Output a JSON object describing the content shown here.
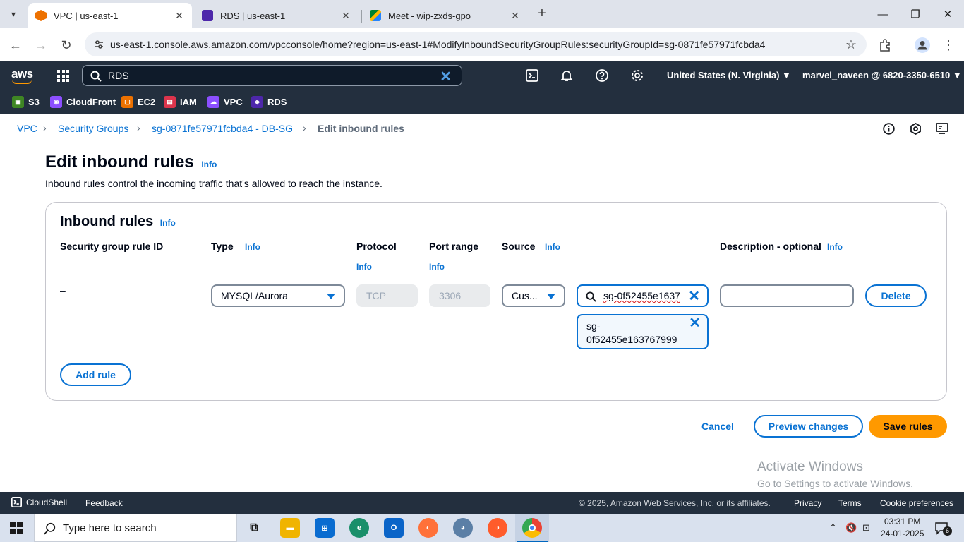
{
  "browser": {
    "tabs": [
      {
        "title": "VPC | us-east-1",
        "active": true,
        "icon": "aws-vpc-favicon"
      },
      {
        "title": "RDS | us-east-1",
        "active": false,
        "icon": "aws-rds-favicon"
      },
      {
        "title": "Meet - wip-zxds-gpo",
        "active": false,
        "icon": "google-meet-favicon"
      }
    ],
    "url": "us-east-1.console.aws.amazon.com/vpcconsole/home?region=us-east-1#ModifyInboundSecurityGroupRules:securityGroupId=sg-0871fe57971fcbda4"
  },
  "aws_nav": {
    "logo": "aws",
    "search_value": "RDS",
    "region": "United States (N. Virginia) ▼",
    "account": "marvel_naveen @ 6820-3350-6510 ▼"
  },
  "favorites": [
    {
      "label": "S3",
      "color": "#3f8624"
    },
    {
      "label": "CloudFront",
      "color": "#8c4fff"
    },
    {
      "label": "EC2",
      "color": "#ed7100"
    },
    {
      "label": "IAM",
      "color": "#dd344c"
    },
    {
      "label": "VPC",
      "color": "#8c4fff"
    },
    {
      "label": "RDS",
      "color": "#4d27aa"
    }
  ],
  "breadcrumb": {
    "items": [
      "VPC",
      "Security Groups",
      "sg-0871fe57971fcbda4 - DB-SG"
    ],
    "current": "Edit inbound rules"
  },
  "page": {
    "title": "Edit inbound rules",
    "info": "Info",
    "description": "Inbound rules control the incoming traffic that's allowed to reach the instance."
  },
  "rules_card": {
    "title": "Inbound rules",
    "info": "Info",
    "columns": {
      "rule_id": "Security group rule ID",
      "type": "Type",
      "protocol": "Protocol",
      "port_range": "Port range",
      "source": "Source",
      "description": "Description - optional",
      "info": "Info"
    },
    "row": {
      "rule_id": "–",
      "type": "MYSQL/Aurora",
      "protocol": "TCP",
      "port_range": "3306",
      "source_type": "Cus...",
      "source_value": "sg-0f52455e1637",
      "token_line1": "sg-",
      "token_line2": "0f52455e163767999",
      "description": "",
      "delete_label": "Delete"
    },
    "add_rule_label": "Add rule"
  },
  "actions": {
    "cancel": "Cancel",
    "preview": "Preview changes",
    "save": "Save rules"
  },
  "watermark": {
    "line1": "Activate Windows",
    "line2": "Go to Settings to activate Windows."
  },
  "footer": {
    "cloudshell": "CloudShell",
    "feedback": "Feedback",
    "copyright": "© 2025, Amazon Web Services, Inc. or its affiliates.",
    "privacy": "Privacy",
    "terms": "Terms",
    "cookies": "Cookie preferences"
  },
  "taskbar": {
    "search_placeholder": "Type here to search",
    "time": "03:31 PM",
    "date": "24-01-2025",
    "notifications": "6"
  },
  "colors": {
    "aws_dark": "#232f3e",
    "link_blue": "#0972d3",
    "primary_orange": "#ff9900"
  }
}
